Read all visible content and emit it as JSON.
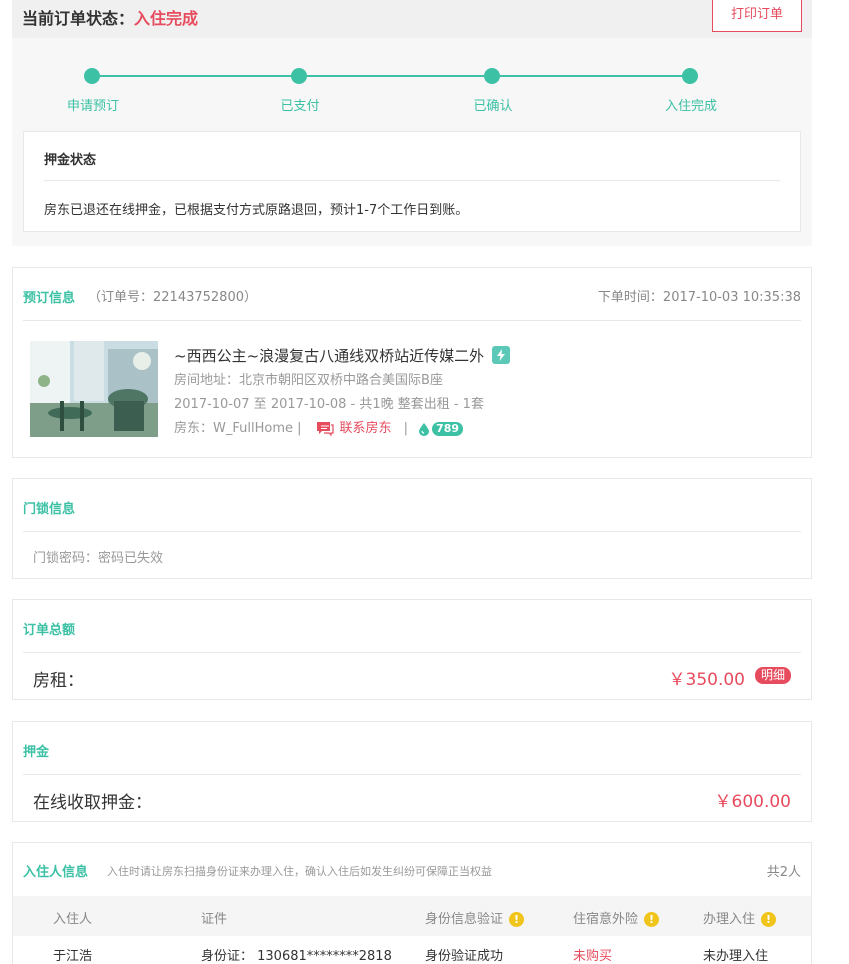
{
  "status": {
    "label": "当前订单状态：",
    "value": "入住完成",
    "print_button": "打印订单",
    "steps": [
      "申请预订",
      "已支付",
      "已确认",
      "入住完成"
    ]
  },
  "deposit_status": {
    "title": "押金状态",
    "text": "房东已退还在线押金，已根据支付方式原路退回，预计1-7个工作日到账。"
  },
  "booking": {
    "title": "预订信息",
    "order_no": "（订单号：22143752800）",
    "order_time": "下单时间：2017-10-03 10:35:38",
    "room_name": "~西西公主~浪漫复古八通线双桥站近传媒二外",
    "address": "房间地址：北京市朝阳区双桥中路合美国际B座",
    "dates": "2017-10-07 至 2017-10-08 - 共1晚  整套出租 - 1套",
    "host": "房东：W_FullHome  |",
    "contact_label": "联系房东",
    "separator": "|",
    "score": "789"
  },
  "lock": {
    "title": "门锁信息",
    "text": "门锁密码：密码已失效"
  },
  "total": {
    "title": "订单总额",
    "label": "房租：",
    "amount": "￥350.00",
    "detail": "明细"
  },
  "deposit": {
    "title": "押金",
    "label": "在线收取押金：",
    "amount": "￥600.00"
  },
  "guests": {
    "title": "入住人信息",
    "hint": "入住时请让房东扫描身份证来办理入住，确认入住后如发生纠纷可保障正当权益",
    "count": "共2人",
    "headers": [
      "入住人",
      "证件",
      "身份信息验证",
      "住宿意外险",
      "办理入住"
    ],
    "rows": [
      {
        "name": "于江浩",
        "id": "身份证：  130681********2818",
        "verify": "身份验证成功",
        "insurance": "未购买",
        "checkin": "未办理入住"
      }
    ]
  },
  "colors": {
    "accent": "#3cc1a5",
    "red": "#e74c5e",
    "warn": "#f0c419"
  }
}
